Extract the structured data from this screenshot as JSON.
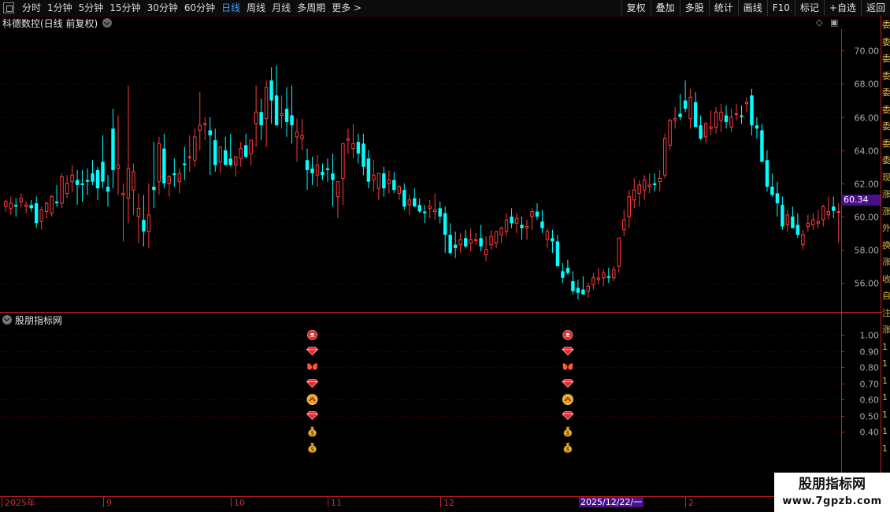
{
  "toolbar": {
    "periods": [
      "分时",
      "1分钟",
      "5分钟",
      "15分钟",
      "30分钟",
      "60分钟",
      "日线",
      "周线",
      "月线",
      "多周期",
      "更多 >"
    ],
    "active_period": "日线",
    "buttons": [
      "复权",
      "叠加",
      "多股",
      "统计",
      "画线",
      "F10",
      "标记",
      "+自选",
      "返回"
    ]
  },
  "chart_title": "科德数控(日线 前复权)",
  "indicator_title": "股朋指标网",
  "current_price": "60.34",
  "cursor_date": "2025/12/22/一",
  "watermark": {
    "line1": "股朋指标网",
    "line2": "www.7gpzb.com"
  },
  "right_strip_glyphs": [
    "委",
    "委",
    "委",
    "委",
    "委",
    "委",
    "委",
    "委",
    "委",
    "现",
    "涨",
    "涨",
    "外",
    "换",
    "涨",
    "收",
    "自",
    "注",
    "涨",
    "1",
    "1",
    "1",
    "1",
    "1",
    "1",
    "1"
  ],
  "colors": {
    "up": "#ff3c3c",
    "down": "#00ffff",
    "grid": "#5a0000",
    "axis": "#cc2020",
    "label": "#aaaaaa"
  },
  "chart_data": [
    {
      "type": "candlestick",
      "title": "科德数控(日线 前复权)",
      "y_ticks": [
        "70.00",
        "68.00",
        "66.00",
        "64.00",
        "62.00",
        "60.00",
        "58.00",
        "56.00"
      ],
      "y_tick_values": [
        70,
        68,
        66,
        64,
        62,
        60,
        58,
        56
      ],
      "ylim": [
        54.2,
        71.3
      ],
      "x_labels": [
        "2025年",
        "9",
        "10",
        "11",
        "12",
        "2"
      ],
      "x_label_index": [
        0,
        19,
        44,
        63,
        85,
        133
      ],
      "last_price": 60.34,
      "ohlc": [
        [
          60.6,
          61.0,
          60.3,
          60.9
        ],
        [
          60.5,
          61.2,
          60.1,
          60.8
        ],
        [
          60.7,
          61.1,
          60.0,
          60.6
        ],
        [
          60.9,
          61.4,
          60.5,
          61.1
        ],
        [
          60.6,
          60.9,
          60.2,
          60.7
        ],
        [
          60.7,
          61.0,
          60.3,
          60.5
        ],
        [
          60.8,
          61.2,
          59.3,
          59.6
        ],
        [
          59.7,
          60.6,
          59.2,
          60.4
        ],
        [
          60.3,
          60.9,
          59.9,
          60.8
        ],
        [
          60.2,
          61.3,
          60.0,
          61.2
        ],
        [
          60.9,
          61.9,
          60.6,
          60.8
        ],
        [
          60.8,
          62.6,
          60.5,
          62.4
        ],
        [
          61.4,
          62.5,
          61.1,
          62.0
        ],
        [
          62.1,
          63.1,
          61.5,
          62.5
        ],
        [
          62.2,
          62.8,
          60.7,
          61.9
        ],
        [
          62.0,
          62.8,
          60.9,
          61.9
        ],
        [
          62.2,
          62.9,
          61.3,
          62.1
        ],
        [
          62.6,
          63.4,
          61.9,
          62.1
        ],
        [
          62.8,
          63.0,
          61.0,
          61.7
        ],
        [
          63.3,
          64.9,
          61.7,
          62.1
        ],
        [
          61.8,
          62.5,
          60.6,
          61.5
        ],
        [
          65.3,
          66.5,
          61.7,
          62.8
        ],
        [
          62.9,
          66.1,
          61.3,
          63.1
        ],
        [
          61.3,
          62.0,
          58.5,
          61.4
        ],
        [
          61.1,
          67.9,
          59.6,
          62.9
        ],
        [
          61.6,
          63.2,
          60.1,
          62.7
        ],
        [
          60.0,
          61.4,
          58.4,
          60.5
        ],
        [
          59.8,
          61.3,
          58.2,
          59.1
        ],
        [
          59.1,
          62.0,
          58.1,
          60.1
        ],
        [
          61.8,
          64.5,
          60.5,
          61.6
        ],
        [
          62.1,
          64.8,
          61.3,
          64.4
        ],
        [
          64.1,
          65.0,
          61.7,
          62.0
        ],
        [
          62.0,
          62.5,
          61.2,
          62.4
        ],
        [
          62.6,
          63.5,
          61.8,
          62.5
        ],
        [
          62.1,
          62.9,
          61.4,
          62.6
        ],
        [
          63.2,
          64.2,
          62.2,
          63.1
        ],
        [
          63.6,
          64.9,
          62.7,
          63.6
        ],
        [
          63.4,
          65.3,
          63.0,
          64.8
        ],
        [
          65.2,
          67.5,
          64.0,
          65.5
        ],
        [
          65.6,
          66.0,
          64.6,
          65.6
        ],
        [
          65.2,
          66.0,
          62.5,
          64.9
        ],
        [
          64.6,
          65.3,
          62.7,
          63.1
        ],
        [
          63.3,
          64.0,
          62.6,
          64.2
        ],
        [
          64.0,
          64.8,
          63.2,
          63.1
        ],
        [
          63.5,
          65.0,
          63.0,
          63.1
        ],
        [
          63.1,
          63.4,
          62.4,
          63.6
        ],
        [
          63.5,
          64.5,
          63.0,
          64.1
        ],
        [
          64.3,
          65.0,
          63.5,
          63.6
        ],
        [
          63.8,
          64.6,
          63.1,
          64.6
        ],
        [
          65.6,
          67.9,
          64.2,
          66.3
        ],
        [
          66.3,
          67.1,
          64.6,
          65.5
        ],
        [
          65.9,
          68.2,
          64.2,
          67.8
        ],
        [
          68.2,
          69.0,
          65.6,
          67.0
        ],
        [
          67.3,
          69.1,
          65.7,
          65.5
        ],
        [
          66.1,
          67.3,
          65.3,
          66.2
        ],
        [
          66.5,
          67.8,
          64.8,
          65.7
        ],
        [
          66.1,
          67.9,
          64.4,
          65.5
        ],
        [
          64.8,
          65.9,
          63.3,
          65.1
        ],
        [
          64.7,
          65.9,
          64.0,
          64.9
        ],
        [
          63.4,
          64.1,
          61.6,
          62.8
        ],
        [
          62.9,
          63.6,
          61.9,
          62.6
        ],
        [
          62.5,
          63.7,
          61.8,
          63.1
        ],
        [
          62.7,
          63.2,
          62.2,
          62.5
        ],
        [
          62.9,
          63.5,
          62.1,
          62.8
        ],
        [
          62.6,
          63.8,
          60.6,
          62.2
        ],
        [
          61.2,
          62.0,
          59.9,
          62.1
        ],
        [
          62.3,
          64.1,
          60.7,
          64.4
        ],
        [
          64.6,
          65.3,
          63.8,
          64.7
        ],
        [
          64.1,
          65.6,
          63.5,
          64.4
        ],
        [
          64.5,
          65.0,
          63.2,
          63.8
        ],
        [
          64.4,
          65.0,
          62.5,
          63.0
        ],
        [
          63.5,
          64.0,
          61.7,
          62.1
        ],
        [
          62.2,
          63.4,
          61.5,
          62.5
        ],
        [
          61.7,
          62.6,
          61.0,
          62.6
        ],
        [
          62.6,
          63.0,
          61.2,
          61.7
        ],
        [
          62.0,
          62.8,
          61.4,
          62.2
        ],
        [
          62.2,
          62.7,
          61.4,
          61.6
        ],
        [
          61.4,
          61.9,
          61.0,
          61.8
        ],
        [
          61.6,
          62.0,
          60.4,
          60.6
        ],
        [
          60.7,
          61.3,
          60.1,
          61.0
        ],
        [
          61.1,
          61.7,
          60.6,
          60.6
        ],
        [
          60.7,
          61.1,
          60.2,
          60.3
        ],
        [
          60.3,
          60.7,
          59.6,
          60.2
        ],
        [
          60.5,
          61.0,
          59.9,
          60.6
        ],
        [
          60.3,
          61.4,
          59.8,
          60.4
        ],
        [
          60.5,
          60.9,
          59.6,
          60.0
        ],
        [
          60.2,
          60.6,
          57.8,
          58.9
        ],
        [
          58.9,
          59.6,
          57.7,
          57.8
        ],
        [
          58.3,
          59.1,
          57.5,
          58.1
        ],
        [
          58.3,
          59.0,
          57.8,
          58.6
        ],
        [
          58.7,
          59.2,
          58.1,
          58.2
        ],
        [
          58.4,
          59.3,
          57.9,
          58.6
        ],
        [
          58.6,
          59.0,
          58.3,
          58.6
        ],
        [
          58.7,
          59.5,
          57.9,
          58.2
        ],
        [
          57.7,
          58.8,
          57.3,
          58.0
        ],
        [
          58.3,
          59.2,
          58.0,
          58.8
        ],
        [
          58.4,
          59.0,
          58.1,
          59.1
        ],
        [
          58.9,
          59.4,
          58.4,
          59.3
        ],
        [
          59.1,
          60.2,
          58.8,
          59.8
        ],
        [
          60.0,
          60.5,
          59.3,
          59.6
        ],
        [
          59.6,
          60.2,
          59.0,
          59.9
        ],
        [
          59.5,
          60.0,
          58.6,
          59.3
        ],
        [
          59.3,
          59.8,
          58.6,
          59.4
        ],
        [
          60.0,
          60.5,
          59.2,
          60.3
        ],
        [
          60.3,
          60.8,
          59.8,
          60.0
        ],
        [
          59.7,
          60.4,
          59.0,
          59.3
        ],
        [
          58.6,
          59.3,
          58.1,
          59.1
        ],
        [
          58.7,
          59.2,
          57.8,
          58.5
        ],
        [
          58.5,
          58.9,
          57.0,
          57.0
        ],
        [
          56.7,
          57.2,
          56.0,
          56.3
        ],
        [
          56.9,
          57.4,
          56.5,
          56.6
        ],
        [
          56.1,
          56.7,
          55.3,
          55.5
        ],
        [
          55.7,
          56.2,
          55.0,
          55.4
        ],
        [
          55.6,
          56.4,
          55.3,
          55.3
        ],
        [
          55.5,
          56.0,
          55.1,
          55.8
        ],
        [
          55.9,
          56.6,
          55.6,
          56.3
        ],
        [
          56.2,
          56.9,
          55.9,
          56.3
        ],
        [
          56.3,
          56.8,
          55.8,
          56.6
        ],
        [
          56.4,
          56.9,
          56.0,
          56.3
        ],
        [
          56.3,
          57.0,
          56.1,
          56.8
        ],
        [
          57.0,
          58.7,
          56.6,
          58.7
        ],
        [
          59.2,
          60.4,
          58.8,
          59.8
        ],
        [
          60.0,
          61.6,
          59.3,
          61.2
        ],
        [
          61.0,
          62.3,
          60.5,
          61.6
        ],
        [
          61.4,
          62.2,
          60.6,
          61.9
        ],
        [
          61.6,
          62.5,
          61.0,
          62.2
        ],
        [
          61.8,
          62.6,
          61.4,
          61.9
        ],
        [
          62.0,
          62.6,
          61.5,
          61.9
        ],
        [
          62.1,
          62.8,
          61.5,
          62.3
        ],
        [
          62.5,
          65.0,
          62.3,
          64.7
        ],
        [
          64.3,
          65.9,
          64.0,
          65.8
        ],
        [
          65.8,
          66.6,
          65.3,
          65.9
        ],
        [
          66.2,
          67.4,
          65.8,
          66.0
        ],
        [
          67.0,
          68.2,
          66.3,
          66.5
        ],
        [
          65.9,
          67.7,
          65.3,
          67.2
        ],
        [
          66.9,
          67.5,
          65.6,
          65.4
        ],
        [
          65.5,
          66.1,
          64.6,
          64.7
        ],
        [
          64.8,
          65.7,
          64.4,
          65.6
        ],
        [
          65.3,
          66.4,
          64.9,
          65.4
        ],
        [
          65.4,
          66.6,
          65.0,
          66.3
        ],
        [
          65.8,
          66.8,
          65.1,
          66.3
        ],
        [
          66.1,
          66.7,
          65.3,
          65.7
        ],
        [
          65.4,
          66.5,
          65.1,
          66.0
        ],
        [
          66.2,
          66.8,
          65.8,
          66.2
        ],
        [
          66.1,
          66.7,
          65.6,
          66.0
        ],
        [
          66.8,
          67.2,
          66.3,
          66.9
        ],
        [
          67.3,
          67.7,
          64.9,
          65.5
        ],
        [
          65.5,
          66.0,
          64.7,
          65.3
        ],
        [
          65.2,
          65.6,
          63.4,
          63.3
        ],
        [
          63.4,
          64.0,
          61.5,
          61.8
        ],
        [
          61.8,
          62.6,
          61.2,
          61.3
        ],
        [
          61.4,
          62.1,
          60.0,
          60.8
        ],
        [
          60.7,
          61.2,
          59.2,
          59.4
        ],
        [
          59.5,
          60.4,
          59.1,
          60.1
        ],
        [
          60.0,
          60.6,
          59.6,
          59.3
        ],
        [
          59.5,
          60.2,
          58.7,
          58.9
        ],
        [
          58.3,
          59.2,
          58.0,
          58.9
        ],
        [
          59.4,
          60.1,
          59.1,
          59.6
        ],
        [
          59.5,
          60.2,
          59.2,
          59.8
        ],
        [
          59.6,
          60.4,
          59.3,
          59.7
        ],
        [
          59.8,
          60.7,
          59.4,
          60.6
        ],
        [
          60.1,
          61.2,
          59.8,
          60.3
        ],
        [
          60.6,
          61.2,
          59.9,
          60.34
        ],
        [
          60.3,
          60.8,
          58.4,
          60.3
        ]
      ]
    },
    {
      "type": "scatter",
      "title": "股朋指标网",
      "y_ticks": [
        "1.00",
        "0.90",
        "0.80",
        "0.70",
        "0.60",
        "0.50",
        "0.40"
      ],
      "y_tick_values": [
        1.0,
        0.9,
        0.8,
        0.7,
        0.6,
        0.5,
        0.4
      ],
      "ylim": [
        0.0,
        1.05
      ],
      "signal_bars": [
        60,
        110
      ],
      "signal_icons": [
        {
          "value": 1.0,
          "icon": "red-circle-icon"
        },
        {
          "value": 0.9,
          "icon": "diamond-icon"
        },
        {
          "value": 0.8,
          "icon": "butterfly-icon"
        },
        {
          "value": 0.7,
          "icon": "diamond-icon"
        },
        {
          "value": 0.6,
          "icon": "gold-up-arrow-icon"
        },
        {
          "value": 0.5,
          "icon": "diamond-icon"
        },
        {
          "value": 0.4,
          "icon": "money-bag-icon"
        }
      ]
    }
  ]
}
